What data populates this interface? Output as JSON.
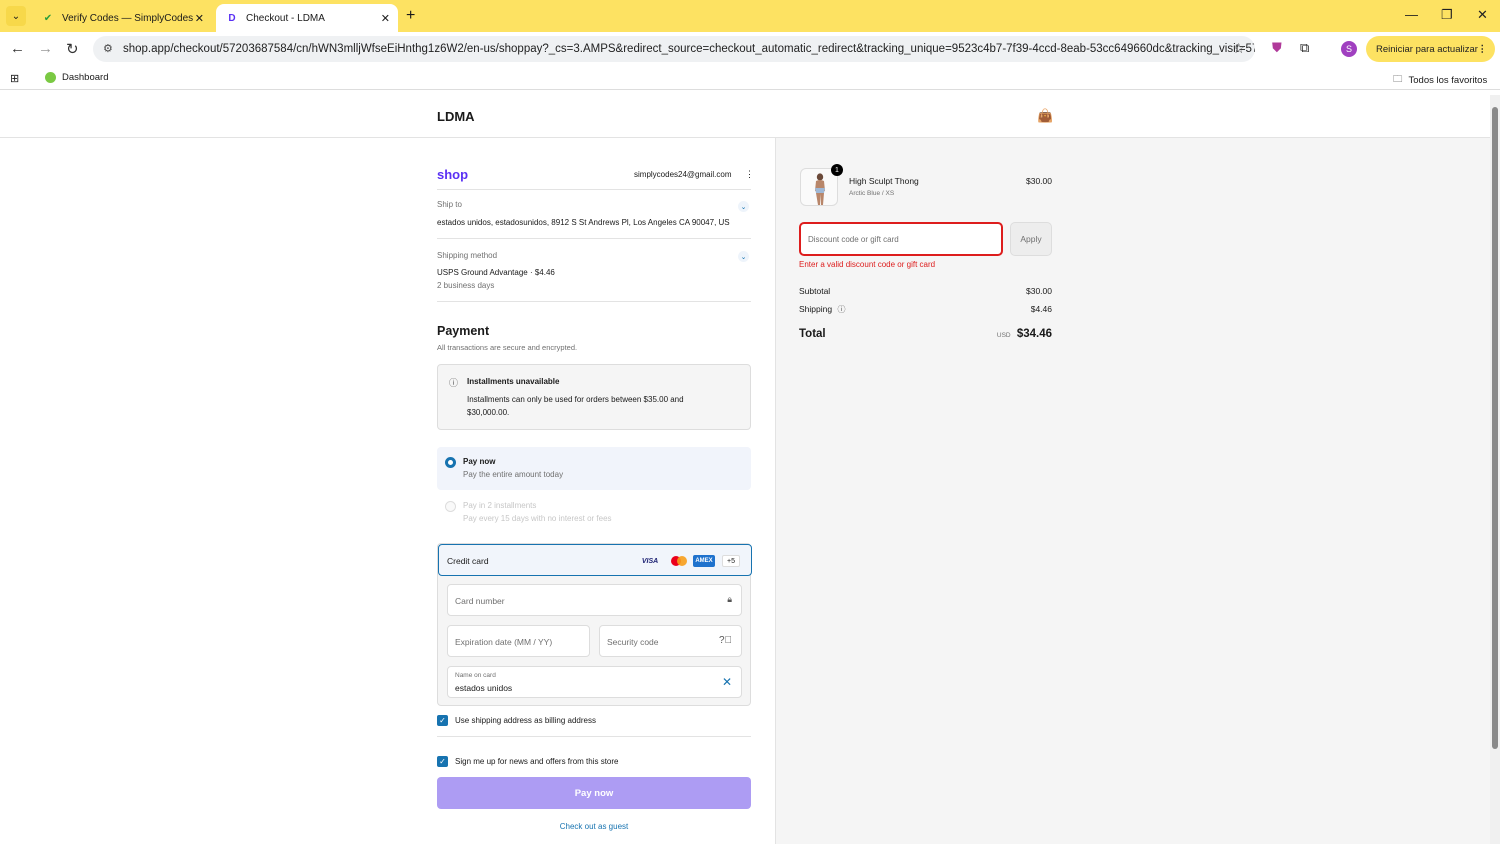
{
  "browser": {
    "tabs": [
      {
        "title": "Verify Codes — SimplyCodes",
        "active": false
      },
      {
        "title": "Checkout - LDMA",
        "active": true
      }
    ],
    "url": "shop.app/checkout/57203687584/cn/hWN3mlljWfseEiHnthg1z6W2/en-us/shoppay?_cs=3.AMPS&redirect_source=checkout_automatic_redirect&tracking_unique=9523c4b7-7f39-4ccd-8eab-53cc649660dc&tracking_visit=570b...",
    "update_label": "Reiniciar para actualizar",
    "profile_initial": "S",
    "bookmarks": {
      "dashboard": "Dashboard",
      "all_favorites": "Todos los favoritos"
    }
  },
  "store": {
    "name": "LDMA"
  },
  "shop": {
    "logo": "shop",
    "email": "simplycodes24@gmail.com",
    "ship_to_label": "Ship to",
    "ship_to_value": "estados unidos, estadosunidos, 8912 S St Andrews Pl, Los Angeles CA 90047, US",
    "shipping_method_label": "Shipping method",
    "shipping_method_value": "USPS Ground Advantage · $4.46",
    "shipping_eta": "2 business days"
  },
  "payment": {
    "title": "Payment",
    "subtitle": "All transactions are secure and encrypted.",
    "notice_title": "Installments unavailable",
    "notice_body": "Installments can only be used for orders between $35.00 and $30,000.00.",
    "option_paynow_title": "Pay now",
    "option_paynow_sub": "Pay the entire amount today",
    "option_install_title": "Pay in 2 installments",
    "option_install_sub": "Pay every 15 days with no interest or fees",
    "credit_card_label": "Credit card",
    "more_cards": "+5",
    "card_number_placeholder": "Card number",
    "expiry_placeholder": "Expiration date (MM / YY)",
    "security_placeholder": "Security code",
    "name_label": "Name on card",
    "name_value": "estados unidos",
    "billing_checkbox": "Use shipping address as billing address",
    "news_checkbox": "Sign me up for news and offers from this store",
    "pay_button": "Pay now",
    "guest_link": "Check out as guest"
  },
  "summary": {
    "product_name": "High Sculpt Thong",
    "product_variant": "Arctic Blue / XS",
    "product_price": "$30.00",
    "quantity": "1",
    "discount_placeholder": "Discount code or gift card",
    "apply_label": "Apply",
    "error": "Enter a valid discount code or gift card",
    "subtotal_label": "Subtotal",
    "subtotal_value": "$30.00",
    "shipping_label": "Shipping",
    "shipping_value": "$4.46",
    "total_label": "Total",
    "currency": "USD",
    "total_value": "$34.46"
  },
  "colors": {
    "chrome_accent": "#fde262",
    "shop_purple": "#5a31f4",
    "link_blue": "#1773b0",
    "error_red": "#dd1d1d",
    "pay_button": "#ad9cf3"
  }
}
